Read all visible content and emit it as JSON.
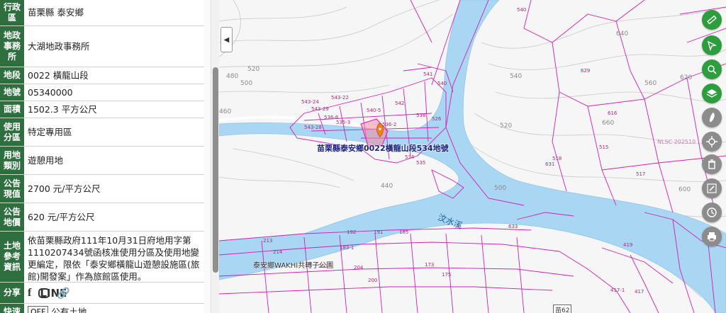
{
  "panel": {
    "rows": [
      {
        "label": "行政區",
        "value": "苗栗縣 泰安鄉"
      },
      {
        "label": "地政事務所",
        "value": "大湖地政事務所"
      },
      {
        "label": "地段",
        "value": "0022 橫龍山段"
      },
      {
        "label": "地號",
        "value": "05340000"
      },
      {
        "label": "面積",
        "value": "1502.3 平方公尺"
      },
      {
        "label": "使用分區",
        "value": "特定專用區"
      },
      {
        "label": "用地類別",
        "value": "遊憩用地"
      },
      {
        "label": "公告現值",
        "value": "2700 元/平方公尺"
      },
      {
        "label": "公告地價",
        "value": "620 元/平方公尺"
      },
      {
        "label": "土地參考資訊",
        "value": "依苗栗縣政府111年10月31日府地用字第1110207434號函核准使用分區及使用地變更編定，限依「泰安鄉橫龍山遊憩設施區(旅館)開發案」作為旅館區使用。"
      },
      {
        "label": "分享",
        "value": ""
      },
      {
        "label": "快速",
        "value": "公有土地"
      }
    ],
    "toggle_label": "OFF",
    "share_icons": [
      "facebook-icon",
      "line-icon",
      "link-icon"
    ]
  },
  "map": {
    "marker_label": "苗栗縣泰安鄉0022橫龍山段534地號",
    "river_label": "汶水溪",
    "park_label": "泰安鄉WAKHI共轉子公園",
    "watermark": "NLSC 202510",
    "road_badge": "苗62",
    "parcels": [
      "543-24",
      "543-22",
      "543-29",
      "540-5",
      "542",
      "536-6",
      "543-28",
      "535-3",
      "543-25",
      "538",
      "535-10",
      "536-1",
      "526",
      "536-2",
      "534",
      "535",
      "630",
      "518",
      "541",
      "540",
      "629",
      "616",
      "515",
      "517",
      "631",
      "633",
      "192",
      "191",
      "185",
      "183-1",
      "214",
      "213",
      "173",
      "175",
      "204",
      "203",
      "200",
      "419",
      "417-1",
      "417"
    ],
    "contours": [
      "480",
      "500",
      "520",
      "540",
      "460",
      "440",
      "660",
      "640",
      "620",
      "600",
      "560"
    ],
    "colors": {
      "parcel": "#d21fb4",
      "water": "#a9d6f2",
      "land": "#f7f7f7",
      "marker": "#f08020",
      "label": "#1a237e"
    }
  },
  "toolbar": {
    "tools": [
      "ruler-icon",
      "select-parcel-icon",
      "locate-parcel-icon",
      "layers-icon",
      "taiwan-icon",
      "gps-icon",
      "trash-icon",
      "edit-icon",
      "history-icon",
      "print-icon"
    ]
  }
}
